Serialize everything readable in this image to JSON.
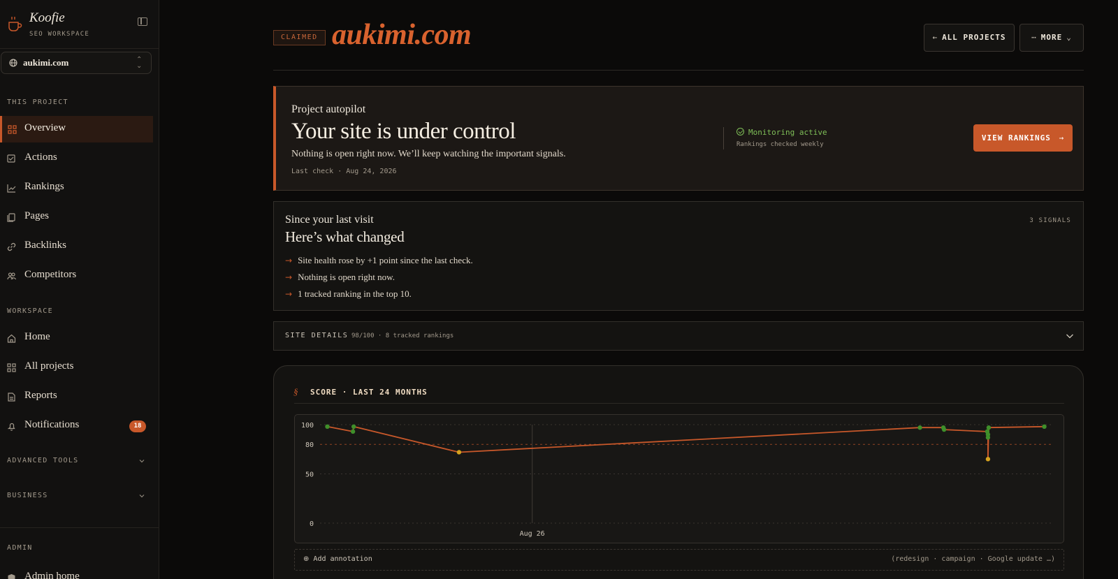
{
  "brand": {
    "name": "Koofie",
    "subtitle": "SEO WORKSPACE"
  },
  "project_selector": {
    "value": "aukimi.com"
  },
  "sidebar": {
    "this_project_label": "THIS PROJECT",
    "project_items": [
      {
        "label": "Overview",
        "icon": "grid-icon",
        "active": true
      },
      {
        "label": "Actions",
        "icon": "checklist-icon"
      },
      {
        "label": "Rankings",
        "icon": "trend-chart-icon"
      },
      {
        "label": "Pages",
        "icon": "pages-icon"
      },
      {
        "label": "Backlinks",
        "icon": "link-icon"
      },
      {
        "label": "Competitors",
        "icon": "users-icon"
      }
    ],
    "workspace_label": "WORKSPACE",
    "workspace_items": [
      {
        "label": "Home",
        "icon": "home-icon"
      },
      {
        "label": "All projects",
        "icon": "grid-icon"
      },
      {
        "label": "Reports",
        "icon": "document-icon"
      },
      {
        "label": "Notifications",
        "icon": "bell-icon",
        "badge": "18"
      }
    ],
    "advanced_tools_label": "ADVANCED TOOLS",
    "business_label": "BUSINESS",
    "admin_label": "ADMIN",
    "admin_items": [
      {
        "label": "Admin home",
        "icon": "shield-icon"
      }
    ]
  },
  "header": {
    "badge": "CLAIMED",
    "title": "aukimi.com",
    "all_projects": "ALL PROJECTS",
    "more": "MORE"
  },
  "autopilot": {
    "kicker": "Project autopilot",
    "headline": "Your site is under control",
    "description": "Nothing is open right now. We’ll keep watching the important signals.",
    "last_check": "Last check · Aug 24, 2026",
    "monitoring": "Monitoring active",
    "frequency": "Rankings checked weekly",
    "cta": "VIEW RANKINGS"
  },
  "changes": {
    "kicker": "Since your last visit",
    "headline": "Here’s what changed",
    "count": "3 SIGNALS",
    "items": [
      "Site health rose by +1 point since the last check.",
      "Nothing is open right now.",
      "1 tracked ranking in the top 10."
    ]
  },
  "site_details": {
    "label": "SITE DETAILS",
    "meta": "98/100 · 8 tracked rankings"
  },
  "score_chart": {
    "symbol": "§",
    "title": "SCORE · LAST 24 MONTHS",
    "add_annotation": "Add annotation",
    "annotation_hint": "(redesign · campaign · Google update …)"
  },
  "colors": {
    "accent": "#c8582a",
    "good": "#3f8f2a",
    "warn": "#d6a21e",
    "monitor_green": "#7fbf58"
  },
  "chart_data": {
    "type": "line",
    "ylim": [
      0,
      100
    ],
    "yticks": [
      100,
      80,
      50,
      0
    ],
    "threshold": 80,
    "xlim": [
      0,
      1
    ],
    "marker": {
      "label": "Aug 26",
      "x": 0.29
    },
    "points": [
      {
        "x": 0.01,
        "y": 98,
        "status": "good"
      },
      {
        "x": 0.045,
        "y": 93,
        "status": "good"
      },
      {
        "x": 0.046,
        "y": 98,
        "status": "good"
      },
      {
        "x": 0.19,
        "y": 72,
        "status": "warn"
      },
      {
        "x": 0.82,
        "y": 97,
        "status": "good"
      },
      {
        "x": 0.852,
        "y": 97,
        "status": "good"
      },
      {
        "x": 0.853,
        "y": 95,
        "status": "good"
      },
      {
        "x": 0.912,
        "y": 93,
        "status": "good"
      },
      {
        "x": 0.913,
        "y": 90,
        "status": "good"
      },
      {
        "x": 0.913,
        "y": 87,
        "status": "good"
      },
      {
        "x": 0.913,
        "y": 65,
        "status": "warn"
      },
      {
        "x": 0.914,
        "y": 97,
        "status": "good"
      },
      {
        "x": 0.99,
        "y": 98,
        "status": "good"
      }
    ]
  }
}
